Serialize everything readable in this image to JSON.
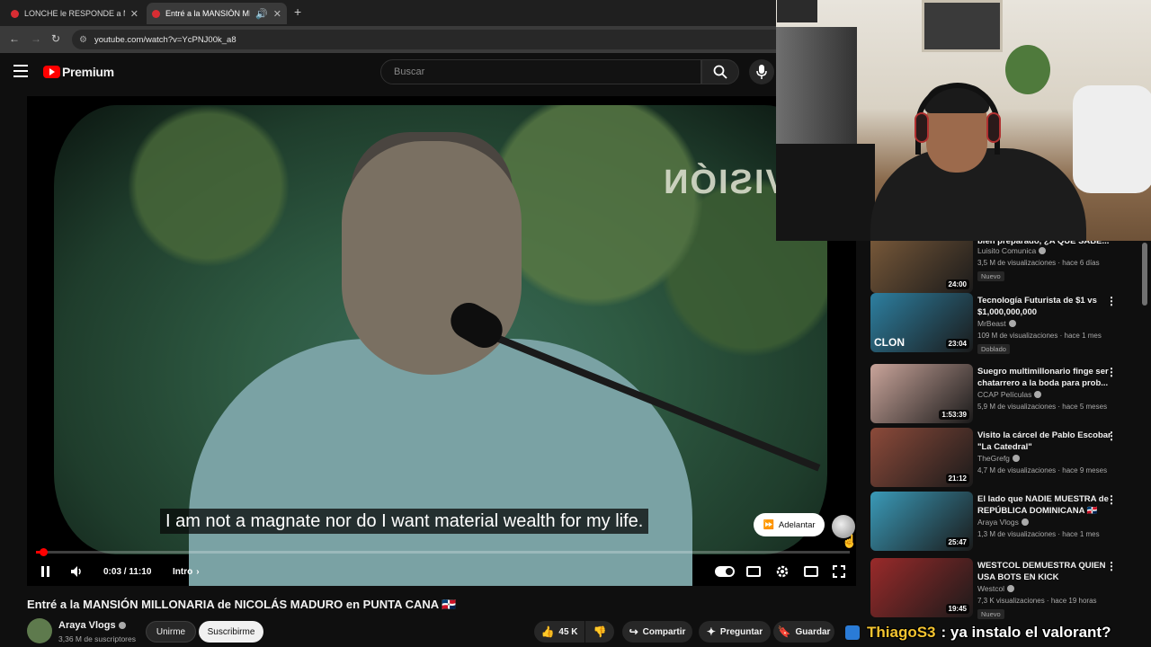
{
  "browser": {
    "tabs": [
      {
        "title": "LONCHE le RESPONDE a MRST",
        "active": false
      },
      {
        "title": "Entré a la MANSIÓN MILLO",
        "active": true
      }
    ],
    "url": "youtube.com/watch?v=YcPNJ00k_a8"
  },
  "header": {
    "logo_text": "Premium",
    "search_placeholder": "Buscar"
  },
  "player": {
    "subtitle": "I am not a magnate nor do I want material wealth for my life.",
    "overlay_text": "LVISIÓN",
    "skip_label": "Adelantar",
    "time": "0:03 / 11:10",
    "chapter": "Intro",
    "progress_fraction": 0.0045
  },
  "video": {
    "title": "Entré a la MANSIÓN MILLONARIA de NICOLÁS MADURO en PUNTA CANA 🇩🇴",
    "channel": "Araya Vlogs",
    "subscribers": "3,36 M de suscriptores",
    "join_label": "Unirme",
    "subscribe_label": "Suscribirme",
    "likes": "45 K",
    "share_label": "Compartir",
    "ask_label": "Preguntar",
    "save_label": "Guardar"
  },
  "recommendations": [
    {
      "title": "bien preparado, ¿A QUE SABE...",
      "channel": "Luisito Comunica",
      "meta": "3,5 M de visualizaciones · hace 6 días",
      "badge": "Nuevo",
      "duration": "24:00",
      "color": "#7a5a3a"
    },
    {
      "title": "Tecnología Futurista de $1 vs $1,000,000,000",
      "channel": "MrBeast",
      "meta": "109 M de visualizaciones · hace 1 mes",
      "badge": "Doblado",
      "duration": "23:04",
      "color": "#2d7fa0",
      "thumb_text": "CLON"
    },
    {
      "title": "Suegro multimillonario finge ser chatarrero a la boda para prob...",
      "channel": "CCAP Películas",
      "meta": "5,9 M de visualizaciones · hace 5 meses",
      "badge": "",
      "duration": "1:53:39",
      "color": "#c9a49a"
    },
    {
      "title": "Visito la cárcel de Pablo Escobar \"La Catedral\"",
      "channel": "TheGrefg",
      "meta": "4,7 M de visualizaciones · hace 9 meses",
      "badge": "",
      "duration": "21:12",
      "color": "#8c4a3a"
    },
    {
      "title": "El lado que NADIE MUESTRA de REPÚBLICA DOMINICANA 🇩🇴",
      "channel": "Araya Vlogs",
      "meta": "1,3 M de visualizaciones · hace 1 mes",
      "badge": "",
      "duration": "25:47",
      "color": "#3a9ab8"
    },
    {
      "title": "WESTCOL DEMUESTRA QUIEN USA BOTS EN KICK",
      "channel": "Westcol",
      "meta": "7,3 K visualizaciones · hace 19 horas",
      "badge": "Nuevo",
      "duration": "19:45",
      "color": "#9a2a2a"
    }
  ],
  "chat": {
    "user": "ThiagoS3",
    "message": ": ya instalo el valorant?"
  }
}
